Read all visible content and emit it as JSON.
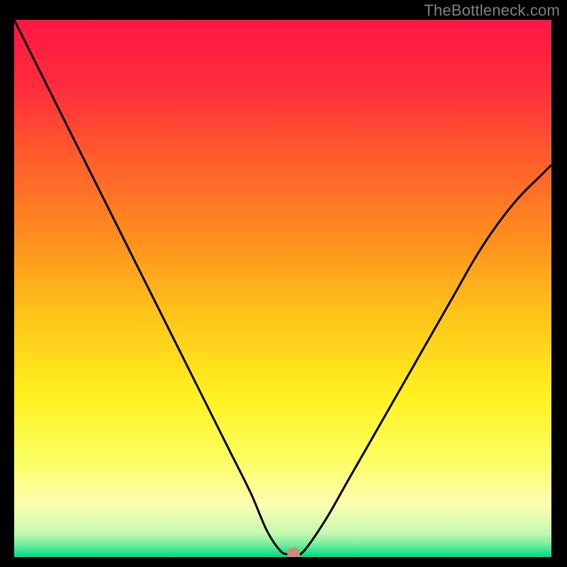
{
  "watermark": "TheBottleneck.com",
  "chart_data": {
    "type": "line",
    "title": "",
    "xlabel": "",
    "ylabel": "",
    "xlim": [
      0,
      100
    ],
    "ylim": [
      0,
      100
    ],
    "background_gradient": {
      "stops": [
        {
          "offset": 0.0,
          "color": "#ff1744"
        },
        {
          "offset": 0.12,
          "color": "#ff2b3d"
        },
        {
          "offset": 0.25,
          "color": "#ff5a2d"
        },
        {
          "offset": 0.4,
          "color": "#ff8c1f"
        },
        {
          "offset": 0.55,
          "color": "#ffc41a"
        },
        {
          "offset": 0.7,
          "color": "#fff020"
        },
        {
          "offset": 0.82,
          "color": "#fbff62"
        },
        {
          "offset": 0.9,
          "color": "#fdffb0"
        },
        {
          "offset": 0.955,
          "color": "#c6f8b0"
        },
        {
          "offset": 0.975,
          "color": "#7eeea0"
        },
        {
          "offset": 0.99,
          "color": "#28e38f"
        },
        {
          "offset": 1.0,
          "color": "#00d984"
        }
      ]
    },
    "series": [
      {
        "name": "bottleneck-curve",
        "color": "#000000",
        "width": 3,
        "x": [
          0,
          4,
          8,
          12,
          16,
          20,
          24,
          28,
          32,
          36,
          40,
          44,
          47,
          49.5,
          51,
          52.5,
          54,
          58,
          62,
          66,
          70,
          74,
          78,
          82,
          86,
          90,
          94,
          98,
          100
        ],
        "y": [
          100,
          92,
          84,
          76,
          68,
          60,
          52,
          44,
          36,
          28,
          20,
          12,
          5,
          1.2,
          0.5,
          0.5,
          1.2,
          7,
          14,
          21,
          28,
          35,
          42,
          49,
          56,
          62,
          67,
          71,
          73
        ]
      }
    ],
    "marker": {
      "name": "min-point",
      "x": 52,
      "y": 0.6,
      "color": "#d08878",
      "radius": 9
    }
  }
}
